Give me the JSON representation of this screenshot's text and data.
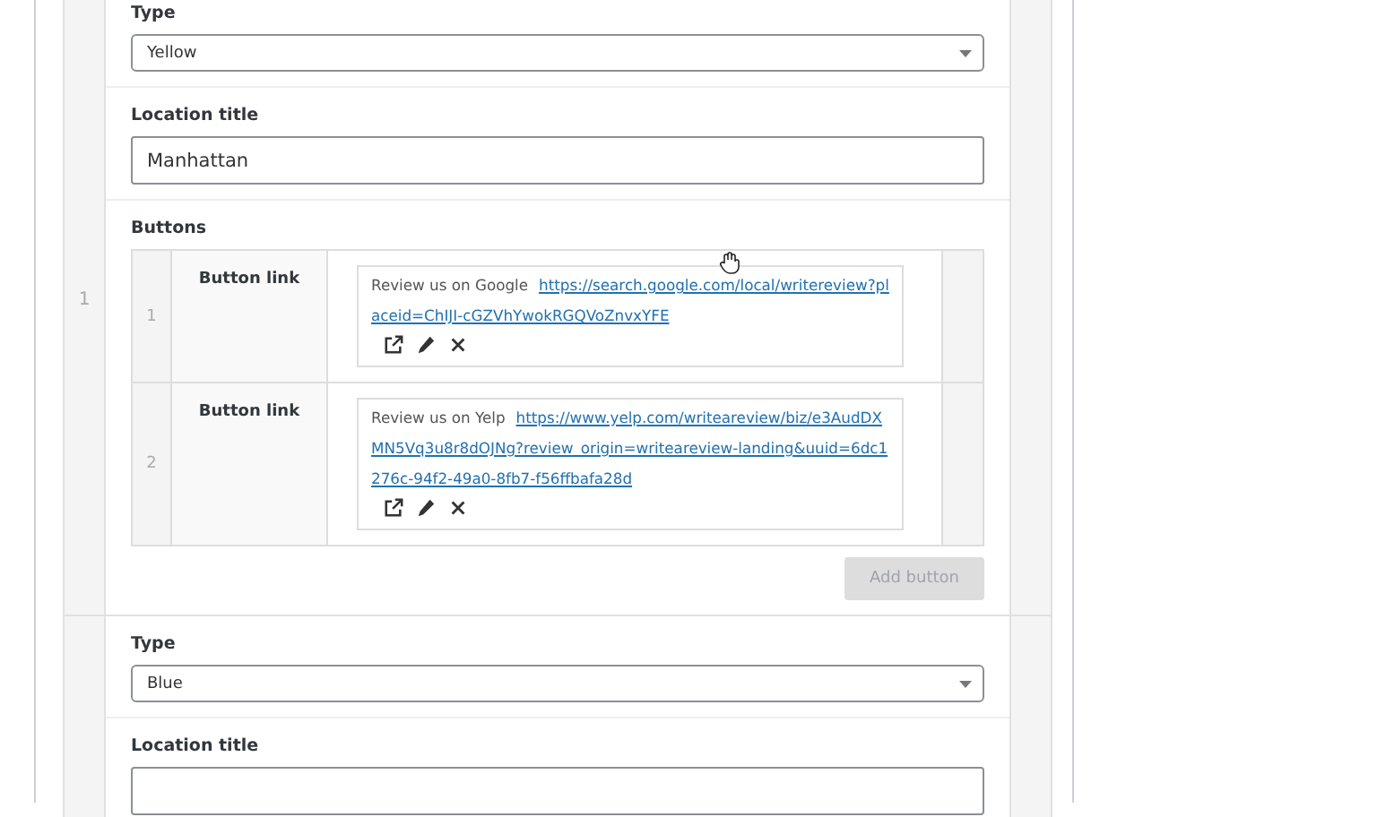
{
  "rows": [
    {
      "index": "1",
      "fields": [
        {
          "kind": "select",
          "label": "Type",
          "value": "Yellow"
        },
        {
          "kind": "text",
          "label": "Location title",
          "value": "Manhattan"
        },
        {
          "kind": "repeater",
          "label": "Buttons",
          "items": [
            {
              "index": "1",
              "label": "Button link",
              "title": "Review us on Google",
              "url": "https://search.google.com/local/writereview?placeid=ChIJI-cGZVhYwokRGQVoZnvxYFE"
            },
            {
              "index": "2",
              "label": "Button link",
              "title": "Review us on Yelp",
              "url": "https://www.yelp.com/writeareview/biz/e3AudDXMN5Vq3u8r8dOJNg?review_origin=writeareview-landing&uuid=6dc1276c-94f2-49a0-8fb7-f56ffbafa28d"
            }
          ],
          "add_button": {
            "label": "Add button",
            "disabled": true
          }
        }
      ]
    },
    {
      "fields": [
        {
          "kind": "select",
          "label": "Type",
          "value": "Blue"
        },
        {
          "kind": "text",
          "label": "Location title"
        }
      ]
    }
  ]
}
